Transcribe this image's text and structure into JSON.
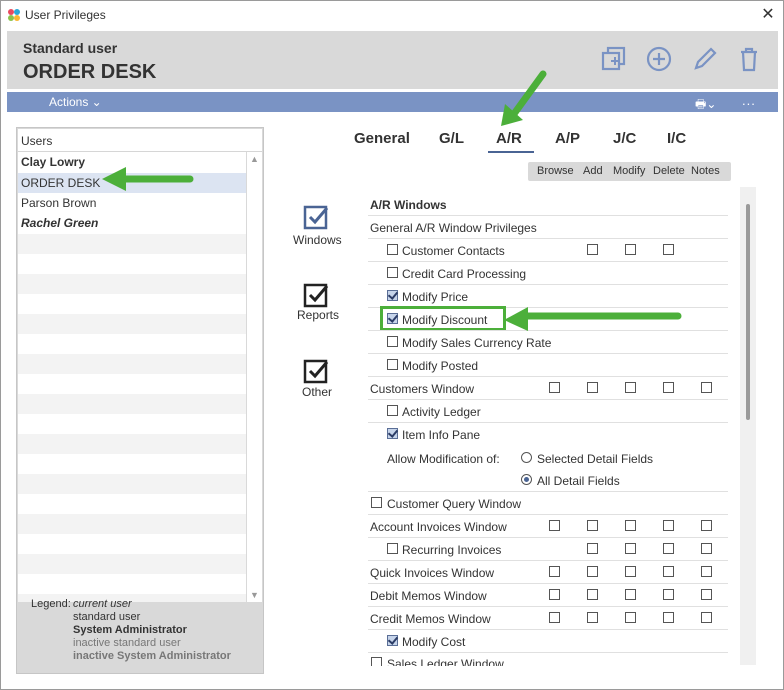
{
  "window": {
    "title": "User Privileges",
    "close_glyph": "✕"
  },
  "header": {
    "subtitle": "Standard user",
    "title": "ORDER DESK"
  },
  "toolbar": {
    "actions_label": "Actions ⌄",
    "printer_label": "🖶⌄",
    "more_label": "..."
  },
  "users": {
    "header": "Users",
    "items": [
      {
        "label": "Clay Lowry",
        "style": "bold"
      },
      {
        "label": "ORDER DESK",
        "style": "selected"
      },
      {
        "label": "Parson Brown",
        "style": "normal"
      },
      {
        "label": "Rachel Green",
        "style": "bold-italic"
      }
    ]
  },
  "legend": {
    "label": "Legend:",
    "current": "current user",
    "standard": "standard user",
    "admin": "System Administrator",
    "inactive": "inactive standard user",
    "inactive_admin": "inactive System Administrator"
  },
  "tabs": [
    "General",
    "G/L",
    "A/R",
    "A/P",
    "J/C",
    "I/C"
  ],
  "active_tab": "A/R",
  "ops": [
    "Browse",
    "Add",
    "Modify",
    "Delete",
    "Notes"
  ],
  "categories": [
    "Windows",
    "Reports",
    "Other"
  ],
  "privileges": {
    "section": "A/R Windows",
    "general": "General A/R Window Privileges",
    "customer_contacts": "Customer Contacts",
    "credit_card": "Credit Card Processing",
    "modify_price": "Modify Price",
    "modify_discount": "Modify Discount",
    "modify_sales_currency": "Modify Sales Currency Rate",
    "modify_posted": "Modify Posted",
    "customers_window": "Customers Window",
    "activity_ledger": "Activity Ledger",
    "item_info_pane": "Item Info Pane",
    "allow_mod": "Allow Modification of:",
    "selected_fields": "Selected Detail Fields",
    "all_fields": "All Detail Fields",
    "customer_query": "Customer Query Window",
    "account_invoices": "Account Invoices Window",
    "recurring_invoices": "Recurring Invoices",
    "quick_invoices": "Quick Invoices Window",
    "debit_memos": "Debit Memos Window",
    "credit_memos": "Credit Memos Window",
    "modify_cost": "Modify Cost",
    "sales_ledger": "Sales Ledger Window"
  },
  "colors": {
    "accent": "#7a93c4",
    "highlight": "#4caf3a",
    "selected_row": "#dce4f2",
    "header_bg": "#d9d9d9"
  }
}
